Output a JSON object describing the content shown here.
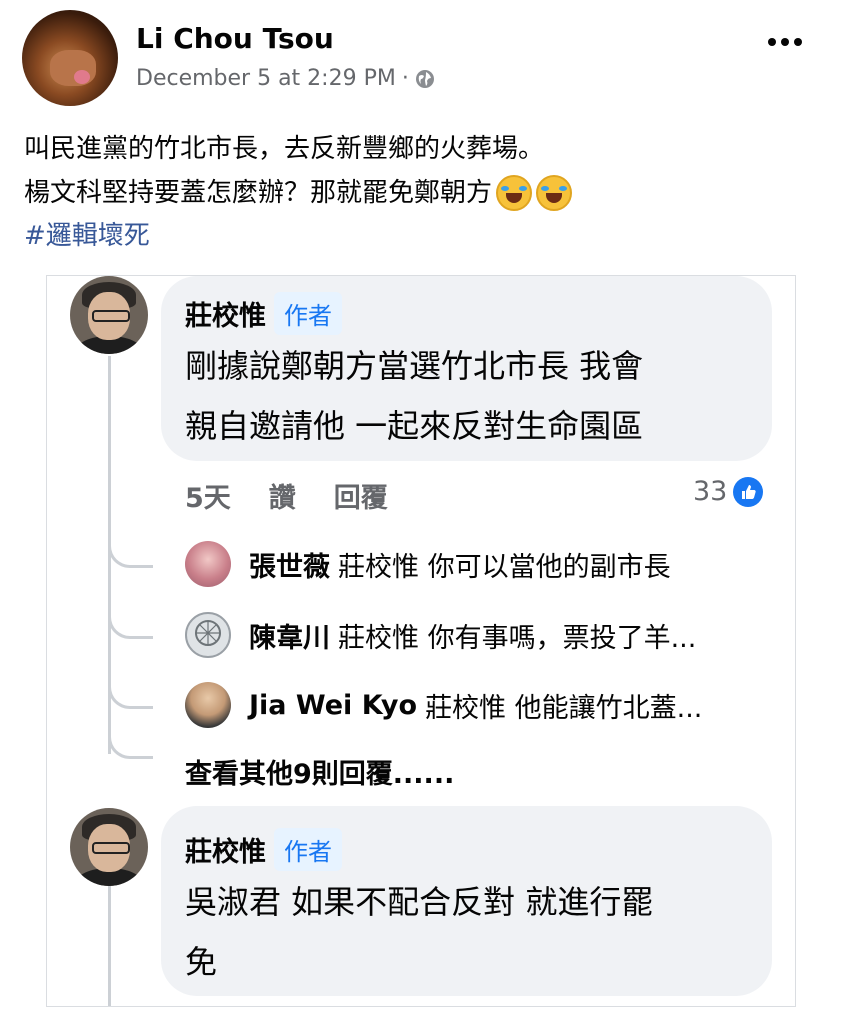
{
  "post": {
    "author": "Li Chou Tsou",
    "timestamp": "December 5 at 2:29 PM",
    "separator": "·",
    "privacy_icon": "globe-icon",
    "menu_icon": "more-icon",
    "text_line1": "叫民進黨的竹北市長，去反新豐鄉的火葬場。",
    "text_line2": "楊文科堅持要蓋怎麼辦？那就罷免鄭朝方",
    "emoji": "rolling-on-floor-laughing-emoji",
    "hashtag": "#邏輯壞死"
  },
  "embed": {
    "comment1": {
      "name": "莊校惟",
      "badge": "作者",
      "line1": "剛據說鄭朝方當選竹北市長 我會",
      "line2": "親自邀請他 一起來反對生命園區",
      "time": "5天",
      "like": "讚",
      "reply": "回覆",
      "reactions": "33",
      "reaction_icon": "like-icon"
    },
    "replies": [
      {
        "name": "張世薇",
        "text": "莊校惟 你可以當他的副市長"
      },
      {
        "name": "陳韋川",
        "text": "莊校惟 你有事嗎，票投了羊..."
      },
      {
        "name": "Jia Wei  Kyo",
        "text": "莊校惟 他能讓竹北蓋..."
      }
    ],
    "more_replies": "查看其他9則回覆......",
    "comment2": {
      "name": "莊校惟",
      "badge": "作者",
      "line1": "吳淑君 如果不配合反對 就進行罷",
      "line2": "免"
    }
  }
}
